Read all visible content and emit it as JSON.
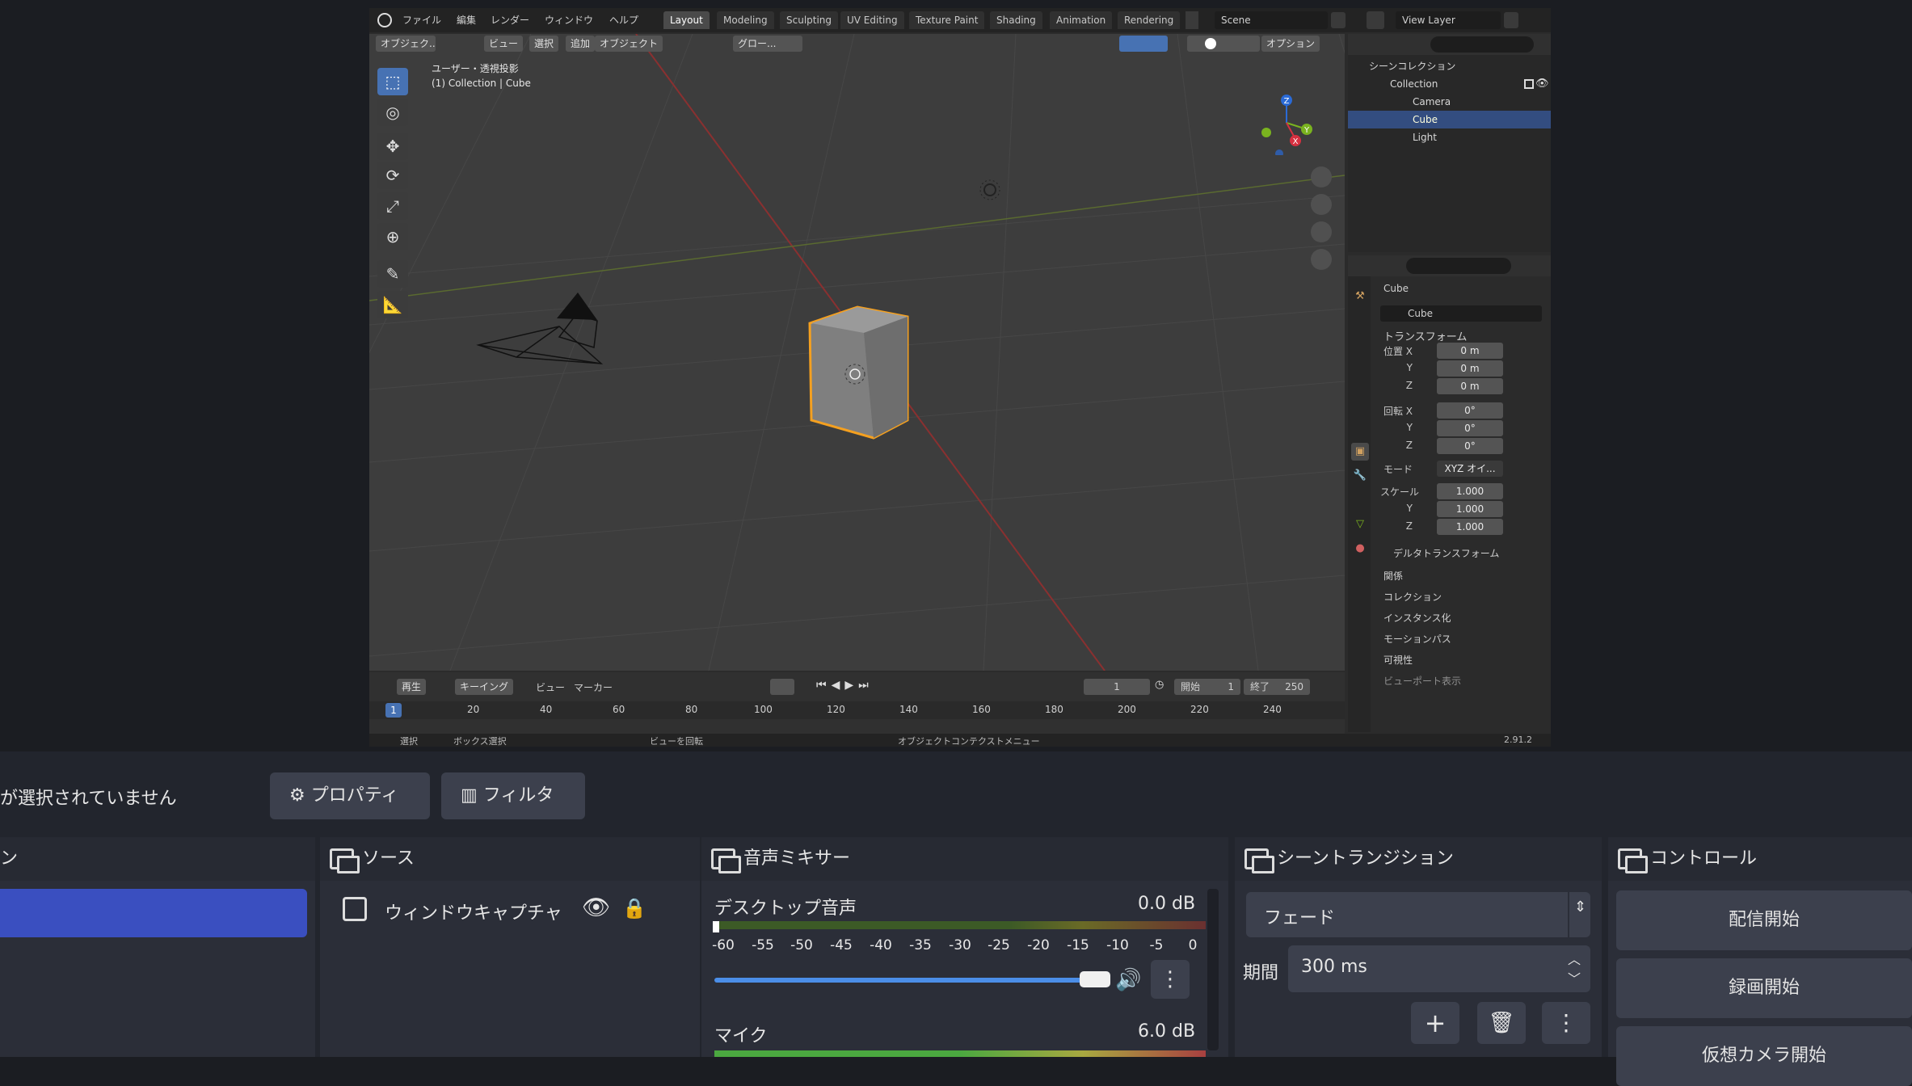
{
  "blender": {
    "menu": [
      "ファイル",
      "編集",
      "レンダー",
      "ウィンドウ",
      "ヘルプ"
    ],
    "workspace_tabs": [
      "Layout",
      "Modeling",
      "Sculpting",
      "UV Editing",
      "Texture Paint",
      "Shading",
      "Animation",
      "Rendering"
    ],
    "active_tab": "Layout",
    "scene_name": "Scene",
    "view_layer": "View Layer",
    "header": {
      "mode": "オブジェク..",
      "view": "ビュー",
      "select": "選択",
      "add": "追加",
      "object": "オブジェクト",
      "transform_orientation": "グロー...",
      "options": "オプション"
    },
    "viewport": {
      "projection": "ユーザー・透視投影",
      "context": "(1) Collection | Cube",
      "gizmo_axes": [
        "Z",
        "Y",
        "X"
      ]
    },
    "outliner": {
      "root": "シーンコレクション",
      "collection": "Collection",
      "items": [
        "Camera",
        "Cube",
        "Light"
      ],
      "selected": "Cube"
    },
    "properties": {
      "object_title": "Cube",
      "object_name": "Cube",
      "transform_section": "トランスフォーム",
      "location_label": "位置 X",
      "location": [
        "0 m",
        "0 m",
        "0 m"
      ],
      "rotation_label": "回転 X",
      "rotation": [
        "0°",
        "0°",
        "0°"
      ],
      "axis_y": "Y",
      "axis_z": "Z",
      "mode_label": "モード",
      "mode_value": "XYZ オイ...",
      "scale_label": "スケール",
      "scale": [
        "1.000",
        "1.000",
        "1.000"
      ],
      "delta_transform": "デルタトランスフォーム",
      "sections": [
        "関係",
        "コレクション",
        "インスタンス化",
        "モーションパス",
        "可視性",
        "ビューポート表示"
      ]
    },
    "timeline": {
      "playback": "再生",
      "keying": "キーイング",
      "view": "ビュー",
      "marker": "マーカー",
      "current_frame": "1",
      "start_label": "開始",
      "start": "1",
      "end_label": "終了",
      "end": "250",
      "ruler": [
        "1",
        "20",
        "40",
        "60",
        "80",
        "100",
        "120",
        "140",
        "160",
        "180",
        "200",
        "220",
        "240"
      ]
    },
    "statusbar": {
      "select": "選択",
      "box_select": "ボックス選択",
      "rotate_view": "ビューを回転",
      "context_menu": "オブジェクトコンテクストメニュー",
      "version": "2.91.2"
    }
  },
  "obs": {
    "no_source_text": "が選択されていません",
    "properties_button": "プロパティ",
    "filters_button": "フィルタ",
    "scenes_title_fragment": "ン",
    "sources": {
      "title": "ソース",
      "items": [
        "ウィンドウキャプチャ"
      ]
    },
    "mixer": {
      "title": "音声ミキサー",
      "channels": [
        {
          "name": "デスクトップ音声",
          "level": "0.0 dB",
          "volume_fraction": 0.96
        },
        {
          "name": "マイク",
          "level": "6.0 dB"
        }
      ],
      "scale": [
        "-60",
        "-55",
        "-50",
        "-45",
        "-40",
        "-35",
        "-30",
        "-25",
        "-20",
        "-15",
        "-10",
        "-5",
        "0"
      ]
    },
    "transitions": {
      "title": "シーントランジション",
      "selected": "フェード",
      "duration_label": "期間",
      "duration": "300 ms"
    },
    "controls": {
      "title": "コントロール",
      "buttons": [
        "配信開始",
        "録画開始",
        "仮想カメラ開始"
      ]
    },
    "colors": {
      "accent": "#3a4fc0",
      "panel": "#2b2e38",
      "header": "#272a33",
      "slider": "#4b8ee8"
    }
  }
}
